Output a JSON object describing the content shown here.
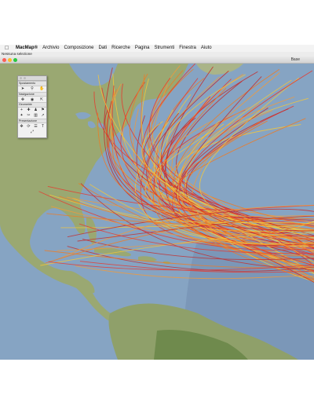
{
  "menubar": {
    "apple_icon": "apple-logo-icon",
    "items": [
      {
        "label": "MacMap®",
        "bold": true
      },
      {
        "label": "Archivio"
      },
      {
        "label": "Composizione"
      },
      {
        "label": "Dati"
      },
      {
        "label": "Ricerche"
      },
      {
        "label": "Pagina"
      },
      {
        "label": "Strumenti"
      },
      {
        "label": "Finestra"
      },
      {
        "label": "Aiuto"
      }
    ]
  },
  "status": {
    "selection_text": "Nessuna selezione"
  },
  "window": {
    "title": "Base"
  },
  "palette": {
    "sections": [
      "Spostamento",
      "Navigazione",
      "Geometrie",
      "Presentazione"
    ],
    "icons": {
      "move": [
        "select-arrow-icon",
        "zoom-icon",
        "hand-icon"
      ],
      "navigation": [
        "pan-icon",
        "globe-icon",
        "scale-icon"
      ],
      "geometry": [
        "add-point-icon",
        "add-node-icon",
        "person-icon",
        "flag-icon",
        "cross-icon",
        "cut-icon",
        "node-edit-icon",
        "measure-icon"
      ],
      "presentation": [
        "move-icon",
        "rotate-icon",
        "align-icon",
        "text-icon",
        "resize-icon"
      ]
    }
  },
  "map": {
    "ocean_color": "#7f9fc0",
    "land_color": "#97a66e",
    "track_colors": [
      "#e8362c",
      "#f07a22",
      "#f4c73a",
      "#c42a2a",
      "#f29a3a"
    ],
    "description_of_layer": "Hurricane tracks"
  }
}
